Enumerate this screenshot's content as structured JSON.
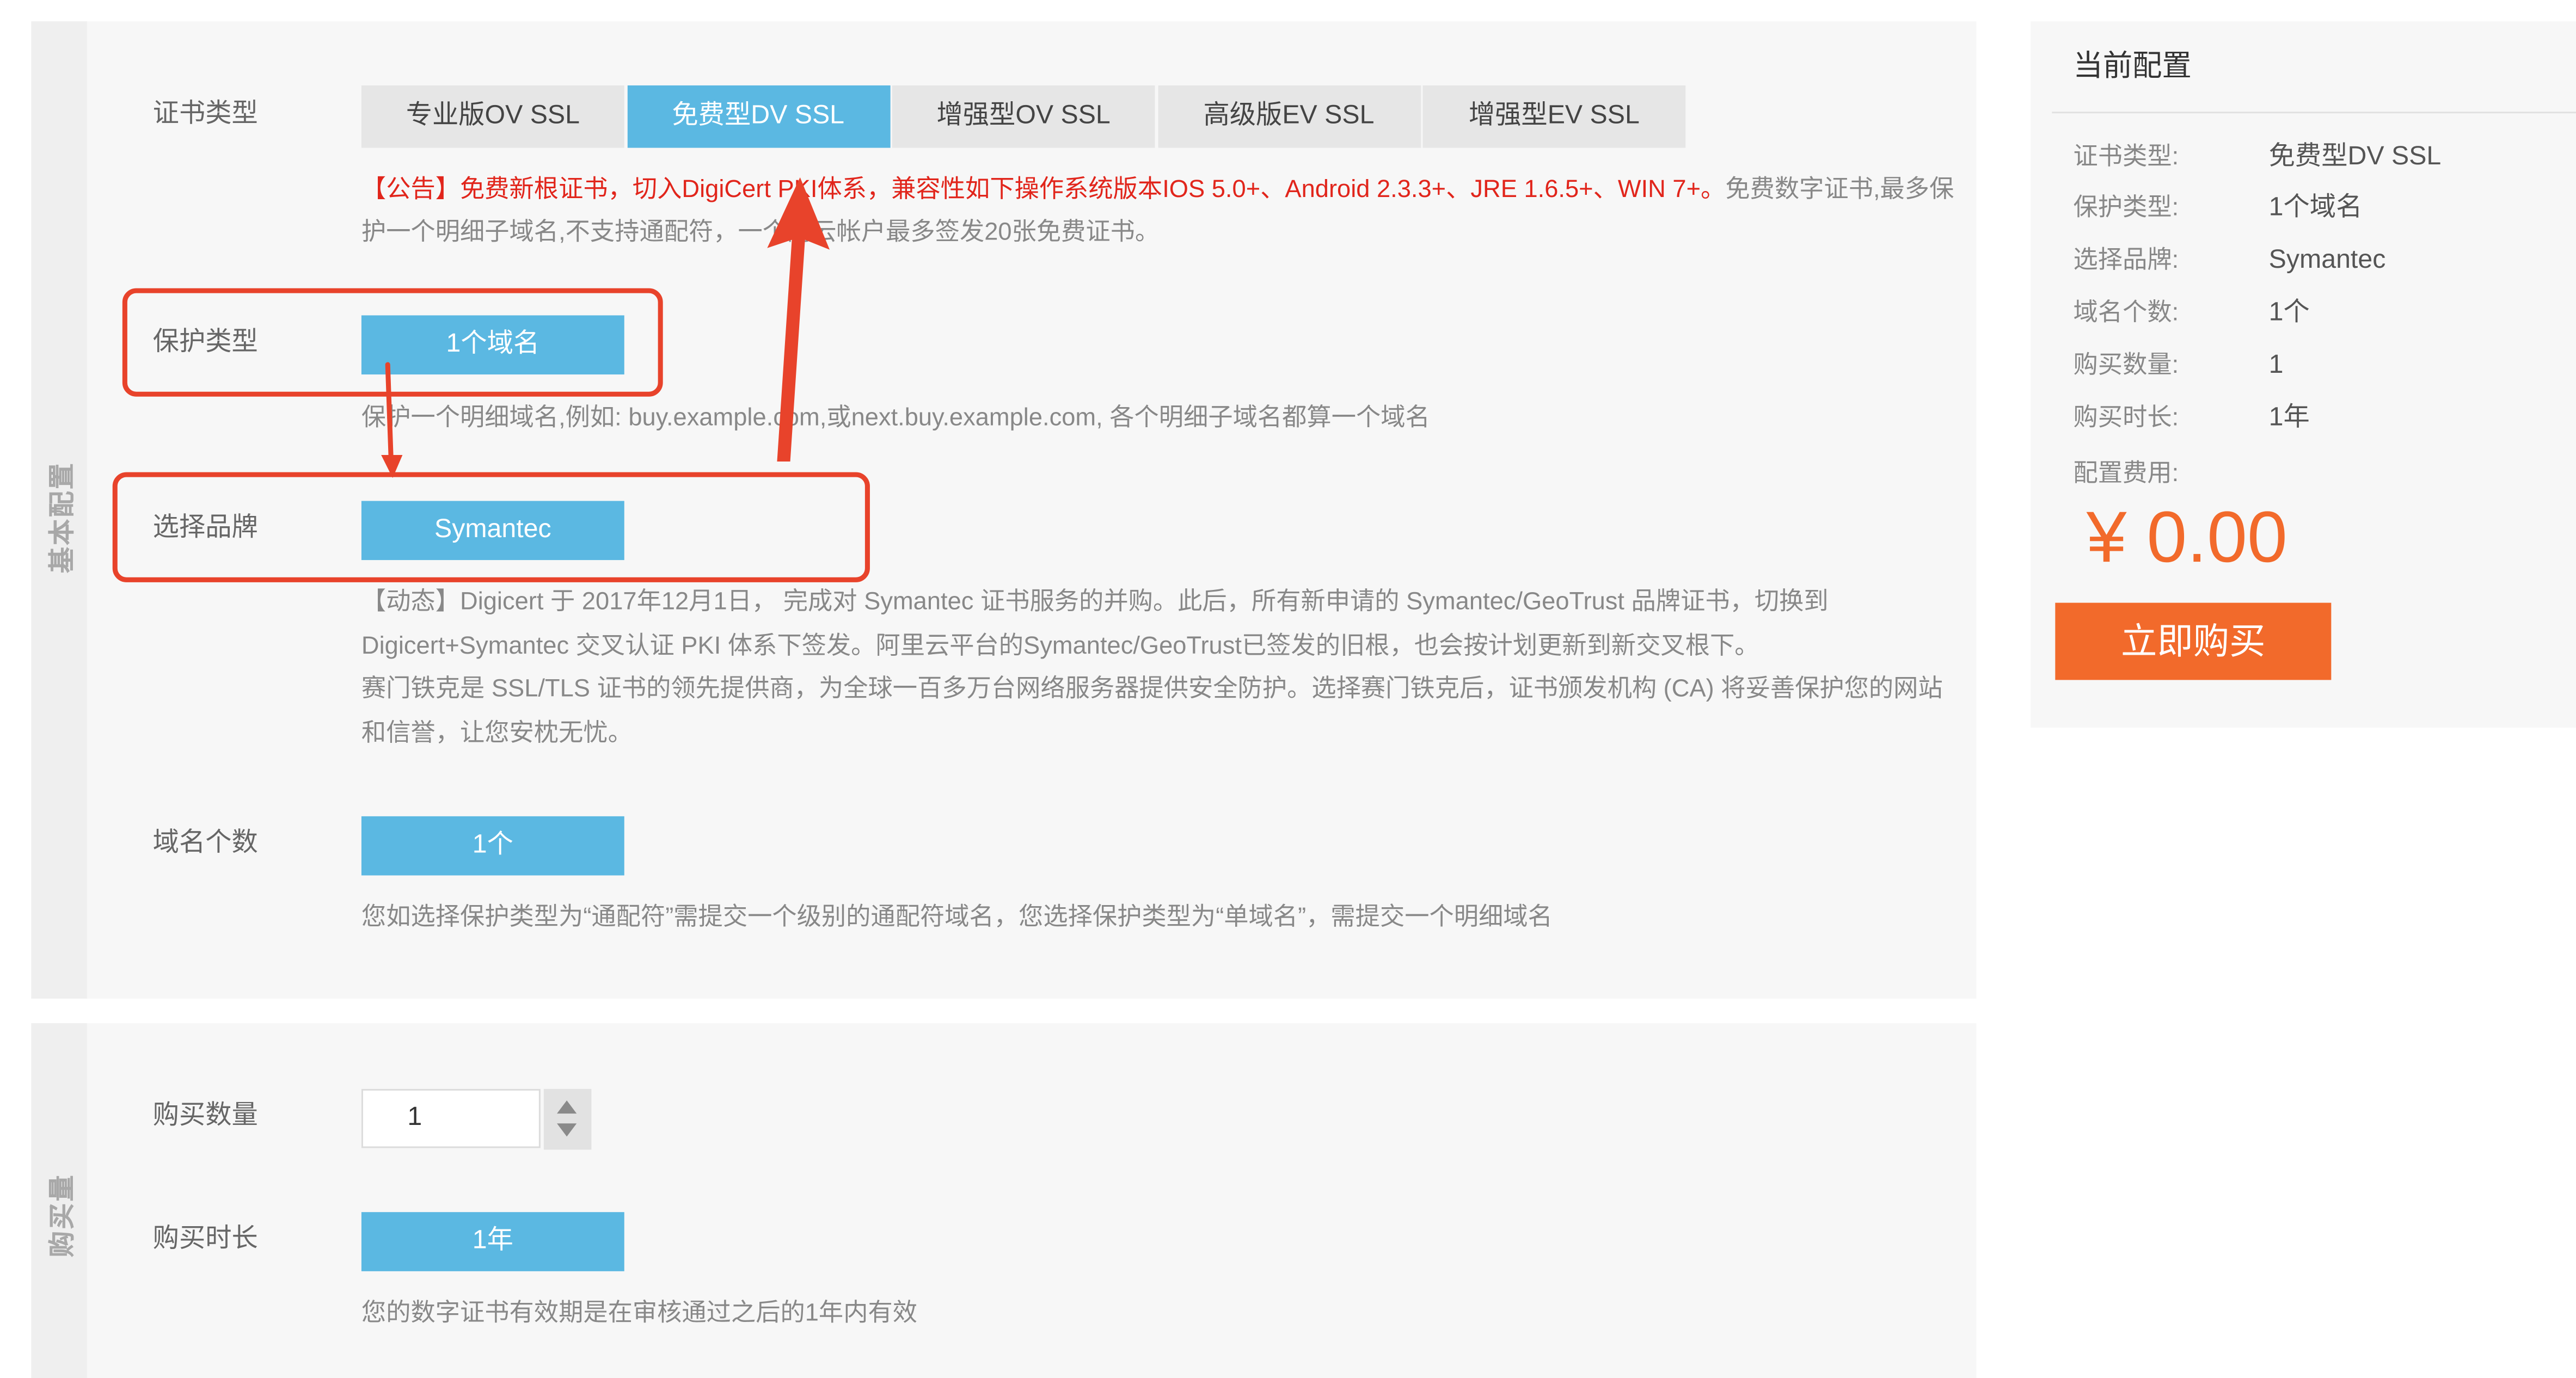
{
  "colors": {
    "accent": "#5bb8e2",
    "tab_bg": "#e6e6e6",
    "notice": "#e1251b",
    "buy": "#f26a2b",
    "annotation": "#e8432b"
  },
  "basic_config": {
    "section_title": "基本配置",
    "cert_type": {
      "label": "证书类型",
      "tabs": [
        {
          "label": "专业版OV SSL",
          "active": false
        },
        {
          "label": "免费型DV SSL",
          "active": true
        },
        {
          "label": "增强型OV SSL",
          "active": false
        },
        {
          "label": "高级版EV SSL",
          "active": false
        },
        {
          "label": "增强型EV SSL",
          "active": false
        }
      ],
      "notice_red": "【公告】免费新根证书，切入DigiCert PKI体系，兼容性如下操作系统版本IOS 5.0+、Android 2.3.3+、JRE 1.6.5+、WIN 7+。",
      "notice_gray": "免费数字证书,最多保护一个明细子域名,不支持通配符，一个阿云帐户最多签发20张免费证书。"
    },
    "protection_type": {
      "label": "保护类型",
      "option": "1个域名",
      "hint": "保护一个明细域名,例如: buy.example.com,或next.buy.example.com, 各个明细子域名都算一个域名"
    },
    "brand": {
      "label": "选择品牌",
      "option": "Symantec",
      "news": "【动态】Digicert 于 2017年12月1日， 完成对 Symantec 证书服务的并购。此后，所有新申请的 Symantec/GeoTrust 品牌证书，切换到Digicert+Symantec 交叉认证 PKI 体系下签发。阿里云平台的Symantec/GeoTrust已签发的旧根，也会按计划更新到新交叉根下。",
      "about": "赛门铁克是 SSL/TLS 证书的领先提供商，为全球一百多万台网络服务器提供安全防护。选择赛门铁克后，证书颁发机构 (CA) 将妥善保护您的网站和信誉，让您安枕无忧。"
    },
    "domain_count": {
      "label": "域名个数",
      "option": "1个",
      "hint": "您如选择保护类型为“通配符”需提交一个级别的通配符域名，您选择保护类型为“单域名”，需提交一个明细域名"
    }
  },
  "purchase": {
    "section_title": "购买量",
    "quantity": {
      "label": "购买数量",
      "value": "1"
    },
    "duration": {
      "label": "购买时长",
      "option": "1年",
      "hint": "您的数字证书有效期是在审核通过之后的1年内有效"
    }
  },
  "summary": {
    "title": "当前配置",
    "rows": [
      {
        "label": "证书类型:",
        "value": "免费型DV SSL"
      },
      {
        "label": "保护类型:",
        "value": "1个域名"
      },
      {
        "label": "选择品牌:",
        "value": "Symantec"
      },
      {
        "label": "域名个数:",
        "value": "1个"
      },
      {
        "label": "购买数量:",
        "value": "1"
      },
      {
        "label": "购买时长:",
        "value": "1年"
      }
    ],
    "fee_label": "配置费用:",
    "price": "¥ 0.00",
    "buy_label": "立即购买"
  }
}
